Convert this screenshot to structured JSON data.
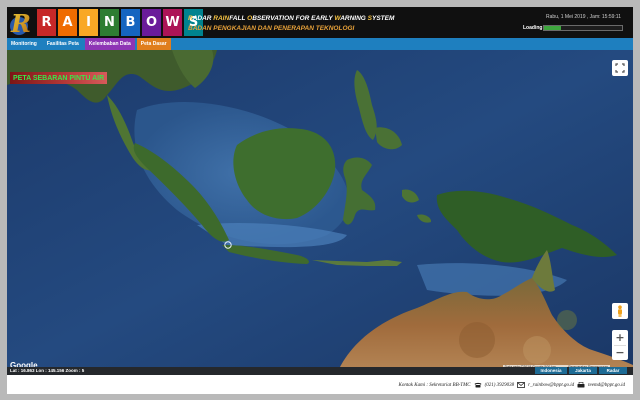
{
  "header": {
    "logo_letters": [
      "R",
      "A",
      "I",
      "N",
      "B",
      "O",
      "W",
      "S"
    ],
    "title_line1_parts": [
      {
        "text": "R",
        "hl": true
      },
      {
        "text": "ADAR ",
        "hl": false
      },
      {
        "text": "RAIN",
        "hl": true
      },
      {
        "text": "FALL ",
        "hl": false
      },
      {
        "text": "O",
        "hl": true
      },
      {
        "text": "BSERVATION FOR EARLY ",
        "hl": false
      },
      {
        "text": "W",
        "hl": true
      },
      {
        "text": "ARNING ",
        "hl": false
      },
      {
        "text": "S",
        "hl": true
      },
      {
        "text": "YSTEM",
        "hl": false
      }
    ],
    "title_line2": "BADAN PENGKAJIAN DAN PENERAPAN TEKNOLOGI",
    "datetime": "Rabu, 1 Mei 2019 , Jam: 15:59:11",
    "loading_label": "Loading",
    "loading_progress": 0.22,
    "colors": {
      "bg": "#101010",
      "accent": "#f5c242"
    }
  },
  "nav": {
    "items": [
      {
        "label": "Monitoring",
        "color": "#1e7fbf"
      },
      {
        "label": "Fasilitas Peta",
        "color": "#1e7fbf"
      },
      {
        "label": "Kelembaban Data",
        "color": "#8e35b5"
      },
      {
        "label": "Peta Dasar",
        "color": "#e07e1d"
      }
    ]
  },
  "map": {
    "title": "PETA SEBARAN PINTU AIR",
    "google_label": "Google",
    "attribution": "Data peta ©2019 Google   500 km ———   Persyaratan Penggunaan",
    "zoom_in": "+",
    "zoom_out": "−"
  },
  "status": {
    "coords": "Lat : 16.863  Lon : 145.156  Zoom : 5",
    "buttons": [
      "Indonesia",
      "Jakarta",
      "Radar"
    ]
  },
  "footer": {
    "contact_label": "Kontak Kami : Sekretariat BB-TMC",
    "phone": "(021) 3929038",
    "email": "r_rainbow@bppt.go.id",
    "fax": "teemd@bppt.go.id"
  }
}
